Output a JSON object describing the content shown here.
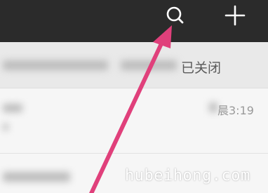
{
  "header": {
    "icons": [
      "search-icon",
      "plus-icon"
    ]
  },
  "notice": {
    "text": "已关闭"
  },
  "chat": {
    "time": "晨3:19"
  },
  "watermark": {
    "text": "hubeihong.com"
  },
  "colors": {
    "header_bg": "#2b2b2b",
    "arrow": "#e0407b"
  }
}
